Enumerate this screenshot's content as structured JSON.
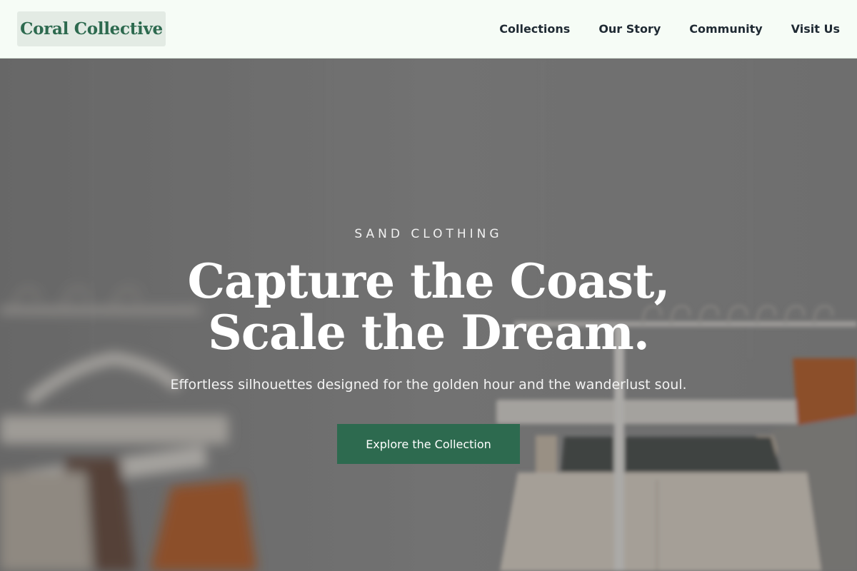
{
  "header": {
    "logo_text": "Coral Collective",
    "nav": [
      {
        "label": "Collections"
      },
      {
        "label": "Our Story"
      },
      {
        "label": "Community"
      },
      {
        "label": "Visit Us"
      }
    ]
  },
  "hero": {
    "eyebrow": "SAND CLOTHING",
    "headline_line1": "Capture the Coast,",
    "headline_line2": "Scale the Dream.",
    "subtitle": "Effortless silhouettes designed for the golden hour and the wanderlust soul.",
    "cta_label": "Explore the Collection",
    "background_image": "clothing-rack-photo"
  },
  "colors": {
    "brand_green": "#2d6a4f",
    "header_bg": "#f6fcf6",
    "logo_bg": "#e3ebe4",
    "nav_text": "#1f2a33",
    "hero_text": "#ffffff"
  }
}
